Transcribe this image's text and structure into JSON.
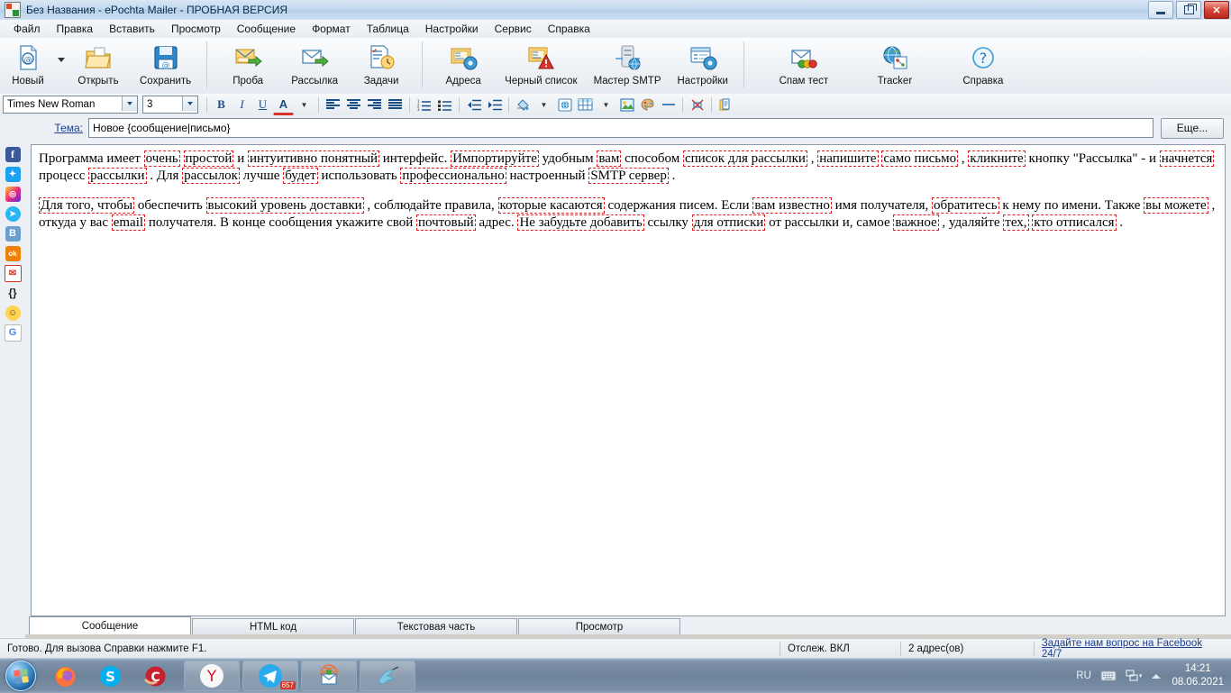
{
  "window": {
    "title": "Без Названия - ePochta Mailer - ПРОБНАЯ ВЕРСИЯ",
    "app_icon": "envelope-document-icon",
    "controls": {
      "minimize": "—",
      "maximize": "❐",
      "close": "✕"
    }
  },
  "menu": {
    "items": [
      {
        "label": "Файл"
      },
      {
        "label": "Правка"
      },
      {
        "label": "Вставить"
      },
      {
        "label": "Просмотр"
      },
      {
        "label": "Сообщение"
      },
      {
        "label": "Формат"
      },
      {
        "label": "Таблица"
      },
      {
        "label": "Настройки"
      },
      {
        "label": "Сервис"
      },
      {
        "label": "Справка"
      }
    ]
  },
  "toolbar": {
    "groups": [
      {
        "buttons": [
          {
            "label": "Новый",
            "icon": "new-document-icon",
            "has_dropdown": true
          },
          {
            "label": "Открыть",
            "icon": "open-folder-icon",
            "has_dropdown": false
          },
          {
            "label": "Сохранить",
            "icon": "save-floppy-icon",
            "has_dropdown": false
          }
        ]
      },
      {
        "buttons": [
          {
            "label": "Проба",
            "icon": "test-send-icon",
            "has_dropdown": false
          },
          {
            "label": "Рассылка",
            "icon": "send-mail-icon",
            "has_dropdown": false
          },
          {
            "label": "Задачи",
            "icon": "tasks-clock-icon",
            "has_dropdown": false
          }
        ]
      },
      {
        "buttons": [
          {
            "label": "Адреса",
            "icon": "address-book-gear-icon",
            "has_dropdown": false
          },
          {
            "label": "Черный список",
            "icon": "blacklist-warning-icon",
            "has_dropdown": false
          },
          {
            "label": "Мастер SMTP",
            "icon": "smtp-server-icon",
            "has_dropdown": false
          },
          {
            "label": "Настройки",
            "icon": "settings-gear-icon",
            "has_dropdown": false
          }
        ]
      },
      {
        "buttons": [
          {
            "label": "Спам тест",
            "icon": "spam-test-icon",
            "has_dropdown": false
          },
          {
            "label": "Tracker",
            "icon": "tracker-globe-icon",
            "has_dropdown": false
          },
          {
            "label": "Справка",
            "icon": "help-question-icon",
            "has_dropdown": false
          }
        ]
      }
    ]
  },
  "formatbar": {
    "font_family": "Times New Roman",
    "font_size": "3",
    "buttons": [
      {
        "name": "bold",
        "glyph": "B"
      },
      {
        "name": "italic",
        "glyph": "I"
      },
      {
        "name": "underline",
        "glyph": "U"
      },
      {
        "name": "font-color",
        "glyph": "A"
      },
      {
        "name": "font-color-dropdown",
        "glyph": "▼"
      },
      {
        "name": "align-left",
        "glyph": ""
      },
      {
        "name": "align-center",
        "glyph": ""
      },
      {
        "name": "align-right",
        "glyph": ""
      },
      {
        "name": "align-justify",
        "glyph": ""
      },
      {
        "name": "numbered-list",
        "glyph": ""
      },
      {
        "name": "bulleted-list",
        "glyph": ""
      },
      {
        "name": "outdent",
        "glyph": ""
      },
      {
        "name": "indent",
        "glyph": ""
      },
      {
        "name": "fill-color",
        "glyph": ""
      },
      {
        "name": "fill-color-dropdown",
        "glyph": "▼"
      },
      {
        "name": "insert-link",
        "glyph": ""
      },
      {
        "name": "insert-table",
        "glyph": ""
      },
      {
        "name": "insert-table-dropdown",
        "glyph": "▼"
      },
      {
        "name": "insert-image",
        "glyph": ""
      },
      {
        "name": "palette",
        "glyph": ""
      },
      {
        "name": "horizontal-rule",
        "glyph": ""
      },
      {
        "name": "clear-formatting",
        "glyph": ""
      },
      {
        "name": "paste-special",
        "glyph": ""
      }
    ]
  },
  "subject": {
    "label": "Тема:",
    "value": "Новое {сообщение|письмо}",
    "placeholder": "",
    "more_button": "Еще..."
  },
  "sidebar": {
    "items": [
      {
        "name": "facebook",
        "glyph": "f",
        "bg": "#3b5998",
        "color": "#ffffff"
      },
      {
        "name": "twitter",
        "glyph": "🐦",
        "bg": "#1da1f2",
        "color": "#ffffff"
      },
      {
        "name": "instagram",
        "glyph": "◉",
        "bg": "#c13584",
        "color": "#ffffff"
      },
      {
        "name": "telegram",
        "glyph": "➤",
        "bg": "#29b6f6",
        "color": "#ffffff"
      },
      {
        "name": "vkontakte",
        "glyph": "B",
        "bg": "#5b88bd",
        "color": "#ffffff"
      },
      {
        "name": "odnoklassniki",
        "glyph": "ok",
        "bg": "#ee8208",
        "color": "#ffffff"
      },
      {
        "name": "email",
        "glyph": "✉",
        "bg": "#ffffff",
        "color": "#d93025"
      },
      {
        "name": "macro-braces",
        "glyph": "{}",
        "bg": "#eceff3",
        "color": "#222222"
      },
      {
        "name": "smiley",
        "glyph": "☺",
        "bg": "#ffd54f",
        "color": "#5d4037"
      },
      {
        "name": "google",
        "glyph": "G",
        "bg": "#ffffff",
        "color": "#4285f4"
      }
    ]
  },
  "editor": {
    "paragraphs": [
      {
        "runs": [
          {
            "t": "Программа имеет ",
            "spin": false
          },
          {
            "t": "очень",
            "spin": true
          },
          {
            "t": " ",
            "spin": false
          },
          {
            "t": "простой",
            "spin": true
          },
          {
            "t": " и ",
            "spin": false
          },
          {
            "t": "интуитивно понятный",
            "spin": true
          },
          {
            "t": " интерфейс. ",
            "spin": false
          },
          {
            "t": "Импортируйте",
            "spin": true
          },
          {
            "t": " удобным ",
            "spin": false
          },
          {
            "t": "вам",
            "spin": true
          },
          {
            "t": " способом ",
            "spin": false
          },
          {
            "t": "список для рассылки",
            "spin": true
          },
          {
            "t": " , ",
            "spin": false
          },
          {
            "t": "напишите",
            "spin": true
          },
          {
            "t": " ",
            "spin": false
          },
          {
            "t": "само письмо",
            "spin": true
          },
          {
            "t": " , ",
            "spin": false
          },
          {
            "t": "кликните",
            "spin": true
          },
          {
            "t": " кнопку \"Рассылка\" - и ",
            "spin": false
          },
          {
            "t": "начнется",
            "spin": true
          },
          {
            "t": " процесс ",
            "spin": false
          },
          {
            "t": "рассылки",
            "spin": true
          },
          {
            "t": " . Для ",
            "spin": false
          },
          {
            "t": "рассылок",
            "spin": true
          },
          {
            "t": " лучше ",
            "spin": false
          },
          {
            "t": "будет",
            "spin": true
          },
          {
            "t": " использовать ",
            "spin": false
          },
          {
            "t": "профессионально",
            "spin": true
          },
          {
            "t": " настроенный ",
            "spin": false
          },
          {
            "t": "SMTP сервер",
            "spin": true
          },
          {
            "t": " .",
            "spin": false
          }
        ]
      },
      {
        "runs": [
          {
            "t": "Для того, чтобы",
            "spin": true
          },
          {
            "t": " обеспечить ",
            "spin": false
          },
          {
            "t": "высокий уровень доставки",
            "spin": true
          },
          {
            "t": " , соблюдайте правила, ",
            "spin": false
          },
          {
            "t": "которые касаются",
            "spin": true
          },
          {
            "t": " содержания писем. Если ",
            "spin": false
          },
          {
            "t": "вам известно",
            "spin": true
          },
          {
            "t": " имя получателя, ",
            "spin": false
          },
          {
            "t": "обратитесь",
            "spin": true
          },
          {
            "t": " к нему по имени. Также ",
            "spin": false
          },
          {
            "t": "вы можете",
            "spin": true
          },
          {
            "t": " , откуда у вас ",
            "spin": false
          },
          {
            "t": "email",
            "spin": true
          },
          {
            "t": " получателя. В конце сообщения укажите свой ",
            "spin": false
          },
          {
            "t": "почтовый",
            "spin": true
          },
          {
            "t": "  адрес. ",
            "spin": false
          },
          {
            "t": "Не забудьте добавить",
            "spin": true
          },
          {
            "t": " ссылку ",
            "spin": false
          },
          {
            "t": "для отписки",
            "spin": true
          },
          {
            "t": " от рассылки и, самое ",
            "spin": false
          },
          {
            "t": "важное",
            "spin": true
          },
          {
            "t": " , удаляйте ",
            "spin": false
          },
          {
            "t": "тех,",
            "spin": true
          },
          {
            "t": " ",
            "spin": false
          },
          {
            "t": "кто отписался",
            "spin": true
          },
          {
            "t": " .",
            "spin": false
          }
        ]
      }
    ]
  },
  "tabs": [
    {
      "label": "Сообщение",
      "active": true
    },
    {
      "label": "HTML код",
      "active": false
    },
    {
      "label": "Текстовая часть",
      "active": false
    },
    {
      "label": "Просмотр",
      "active": false
    }
  ],
  "statusbar": {
    "message": "Готово. Для вызова Справки нажмите F1.",
    "tracking": "Отслеж. ВКЛ",
    "addresses": "2 адрес(ов)",
    "link": "Задайте нам вопрос на Facebook 24/7"
  },
  "taskbar": {
    "start": "start-orb",
    "pinned": [
      {
        "name": "firefox",
        "glyph": "🦊"
      },
      {
        "name": "skype",
        "glyph": "S"
      },
      {
        "name": "ccleaner",
        "glyph": "C"
      }
    ],
    "tasks": [
      {
        "name": "yandex-browser",
        "glyph": "Y",
        "badge": ""
      },
      {
        "name": "telegram",
        "glyph": "➤",
        "badge": "657"
      },
      {
        "name": "epochta-mailer",
        "glyph": "✉",
        "badge": ""
      },
      {
        "name": "colibri",
        "glyph": "🐦",
        "badge": ""
      }
    ],
    "tray": {
      "language": "RU",
      "keyboard_icon": "keyboard-icon",
      "network_icon": "network-icon",
      "show_hidden_icon": "chevron-up-icon",
      "time": "14:21",
      "date": "08.06.2021"
    }
  },
  "colors": {
    "accent": "#1a3f8f",
    "spin_border": "#e02020",
    "title_text": "#0a2a47"
  }
}
